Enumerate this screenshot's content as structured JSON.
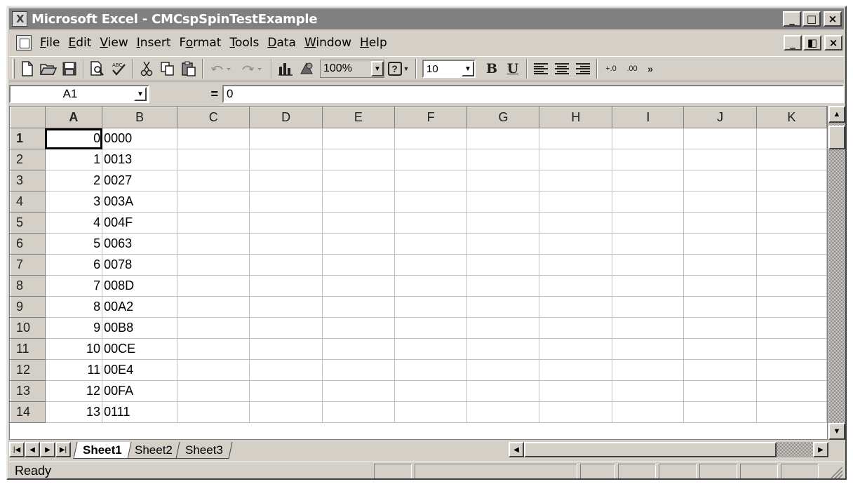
{
  "window": {
    "title": "Microsoft Excel - CMCspSpinTestExample",
    "controls": {
      "minimize": "_",
      "maximize": "□",
      "close": "×",
      "restore": "◧"
    }
  },
  "menu": [
    {
      "pre": "",
      "key": "F",
      "post": "ile"
    },
    {
      "pre": "",
      "key": "E",
      "post": "dit"
    },
    {
      "pre": "",
      "key": "V",
      "post": "iew"
    },
    {
      "pre": "",
      "key": "I",
      "post": "nsert"
    },
    {
      "pre": "F",
      "key": "o",
      "post": "rmat"
    },
    {
      "pre": "",
      "key": "T",
      "post": "ools"
    },
    {
      "pre": "",
      "key": "D",
      "post": "ata"
    },
    {
      "pre": "",
      "key": "W",
      "post": "indow"
    },
    {
      "pre": "",
      "key": "H",
      "post": "elp"
    }
  ],
  "toolbar": {
    "zoom": "100%",
    "font_size": "10",
    "bold": "B",
    "underline": "U",
    "increase_decimal": "+.0",
    "decrease_decimal": ".00",
    "more": "»",
    "help": "?"
  },
  "formula_bar": {
    "name_box": "A1",
    "equals": "=",
    "content": "0"
  },
  "grid": {
    "columns": [
      "A",
      "B",
      "C",
      "D",
      "E",
      "F",
      "G",
      "H",
      "I",
      "J",
      "K"
    ],
    "active_column": "A",
    "active_row": "1",
    "rows": [
      {
        "num": "1",
        "a": "0",
        "b": "0000"
      },
      {
        "num": "2",
        "a": "1",
        "b": "0013"
      },
      {
        "num": "3",
        "a": "2",
        "b": "0027"
      },
      {
        "num": "4",
        "a": "3",
        "b": "003A"
      },
      {
        "num": "5",
        "a": "4",
        "b": "004F"
      },
      {
        "num": "6",
        "a": "5",
        "b": "0063"
      },
      {
        "num": "7",
        "a": "6",
        "b": "0078"
      },
      {
        "num": "8",
        "a": "7",
        "b": "008D"
      },
      {
        "num": "9",
        "a": "8",
        "b": "00A2"
      },
      {
        "num": "10",
        "a": "9",
        "b": "00B8"
      },
      {
        "num": "11",
        "a": "10",
        "b": "00CE"
      },
      {
        "num": "12",
        "a": "11",
        "b": "00E4"
      },
      {
        "num": "13",
        "a": "12",
        "b": "00FA"
      },
      {
        "num": "14",
        "a": "13",
        "b": "0111"
      }
    ]
  },
  "sheets": {
    "tabs": [
      "Sheet1",
      "Sheet2",
      "Sheet3"
    ],
    "active": "Sheet1"
  },
  "status": {
    "text": "Ready"
  }
}
